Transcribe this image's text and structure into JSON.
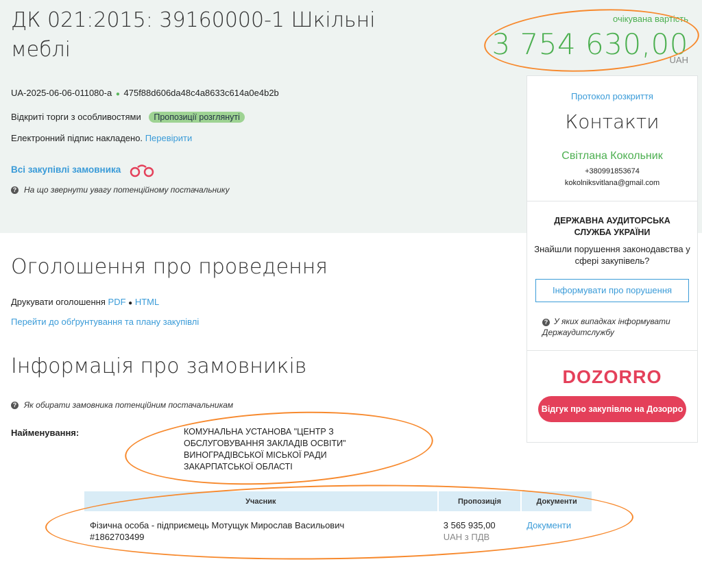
{
  "tender": {
    "title": "ДК 021:2015: 39160000-1 Шкільні меблі",
    "id": "UA-2025-06-06-011080-a",
    "hash": "475f88d606da48c4a8633c614a0e4b2b",
    "procedure": "Відкриті торги з особливостями",
    "status": "Пропозиції розглянуті",
    "signature_text": "Електронний підпис накладено.",
    "verify_link": "Перевірити",
    "all_purchases_link": "Всі закупівлі замовника",
    "hint": "На що звернути увагу потенційному постачальнику"
  },
  "value": {
    "label": "очікувана вартість",
    "amount": "3 754 630,00",
    "currency": "UAH"
  },
  "sidebar": {
    "protocol_link": "Протокол розкриття",
    "contacts_title": "Контакти",
    "contact_name": "Світлана Кокольник",
    "phone": "+380991853674",
    "email": "kokolniksvitlana@gmail.com",
    "dasu_title": "ДЕРЖАВНА АУДИТОРСЬКА СЛУЖБА УКРАЇНИ",
    "dasu_question": "Знайшли порушення законодавства у сфері закупівель?",
    "report_button": "Інформувати про порушення",
    "report_hint": "У яких випадках інформувати Держаудитслужбу",
    "dozorro_logo": "DOZORRO",
    "dozorro_button": "Відгук про закупівлю на Дозорро"
  },
  "announcement": {
    "title": "Оголошення про проведення",
    "print_label": "Друкувати оголошення",
    "pdf_link": "PDF",
    "html_link": "HTML",
    "plan_link": "Перейти до обґрунтування та плану закупівлі"
  },
  "customers": {
    "title": "Інформація про замовників",
    "hint": "Як обирати замовника потенційним постачальникам",
    "name_label": "Найменування:",
    "name_value": "КОМУНАЛЬНА УСТАНОВА \"ЦЕНТР З ОБСЛУГОВУВАННЯ ЗАКЛАДІВ ОСВІТИ\" ВИНОГРАДІВСЬКОЇ МІСЬКОЇ РАДИ ЗАКАРПАТСЬКОЇ ОБЛАСТІ"
  },
  "bids_table": {
    "headers": [
      "Учасник",
      "Пропозиція",
      "Документи"
    ],
    "rows": [
      {
        "participant": "Фізична особа - підприємець Мотущук Мирослав Васильович #1862703499",
        "amount": "3 565 935,00",
        "vat": "UAH з ПДВ",
        "documents": "Документи"
      }
    ]
  },
  "colors": {
    "accent_green": "#4caf50",
    "link_blue": "#3a9bd8",
    "dozorro_red": "#e4405a",
    "annotation_orange": "#f7892d"
  }
}
